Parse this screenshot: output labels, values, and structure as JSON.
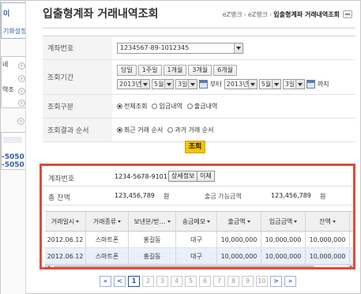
{
  "sidebar": {
    "top_text_1": "이",
    "top_text_2": "기화설정",
    "menu_items": [
      "네",
      "역조",
      "",
      ""
    ],
    "phone_1": "-5050",
    "phone_2": "-5050"
  },
  "header": {
    "title": "입출형계좌 거래내역조회",
    "breadcrumb": [
      "eZ뱅크",
      "eZ뱅크",
      "입출형계좌 거래내역조회"
    ]
  },
  "form": {
    "account_label": "계좌번호",
    "account_value": "1234567-89-1012345",
    "period_label": "조회기간",
    "period_buttons": [
      "당일",
      "1주일",
      "1개월",
      "3개월",
      "6개월"
    ],
    "from": {
      "year": "2013년",
      "month": "5월",
      "day": "3일"
    },
    "from_suffix": "부터",
    "to": {
      "year": "2013년",
      "month": "5월",
      "day": "3일"
    },
    "to_suffix": "까지",
    "type_label": "조회구분",
    "type_options": [
      "전체조회",
      "입금내역",
      "출금내역"
    ],
    "order_label": "조회결과 순서",
    "order_options": [
      "최근 거래 순서",
      "과거 거래 순서"
    ],
    "search_button": "조회"
  },
  "result": {
    "account_label": "계좌번호",
    "account_value": "1234-5678-91011",
    "detail_button": "상세정보",
    "transfer_button": "이체",
    "balance_label": "총 잔액",
    "balance_value": "123,456,789",
    "balance_unit": "원",
    "available_label": "출금 가능금액",
    "available_value": "123,456,789",
    "available_unit": "원",
    "columns": [
      "거래일시",
      "거래종류",
      "보낸분/받…",
      "송금메모",
      "출금액",
      "입금금액",
      "잔액"
    ],
    "rows": [
      [
        "2012.06.12",
        "스마트폰",
        "홍길동",
        "대구",
        "10,000,000",
        "10,000,000",
        "10,000,000"
      ],
      [
        "2012.06.12",
        "스마트폰",
        "홍길동",
        "대구",
        "10,000,000",
        "10,000,000",
        "10,000,000"
      ]
    ]
  },
  "pagination": {
    "first": "«",
    "prev": "<",
    "pages": [
      "1",
      "2",
      "3",
      "4",
      "5",
      "6",
      "7",
      "8",
      "9",
      "10"
    ],
    "current": "1",
    "next": ">",
    "last": "»"
  }
}
